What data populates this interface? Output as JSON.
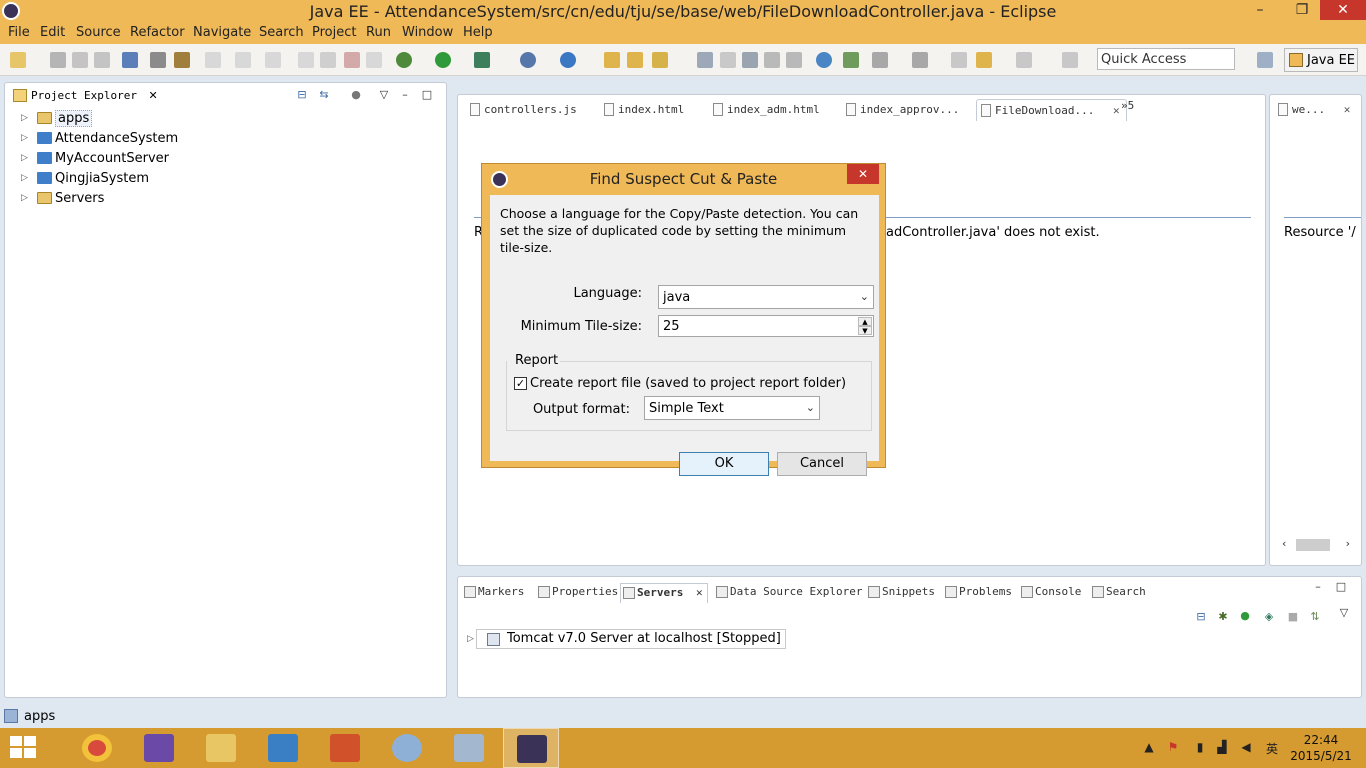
{
  "window": {
    "title": "Java EE - AttendanceSystem/src/cn/edu/tju/se/base/web/FileDownloadController.java - Eclipse",
    "minimize": "–",
    "maximize": "❐",
    "close": "✕"
  },
  "menu": [
    "File",
    "Edit",
    "Source",
    "Refactor",
    "Navigate",
    "Search",
    "Project",
    "Run",
    "Window",
    "Help"
  ],
  "toolbar": {
    "quick_access_placeholder": "Quick Access",
    "perspective_label": "Java EE"
  },
  "project_explorer": {
    "title": "Project Explorer",
    "close": "✕",
    "items": [
      {
        "label": "apps"
      },
      {
        "label": "AttendanceSystem"
      },
      {
        "label": "MyAccountServer"
      },
      {
        "label": "QingjiaSystem"
      },
      {
        "label": "Servers"
      }
    ]
  },
  "editor": {
    "tabs": [
      {
        "label": "controllers.js"
      },
      {
        "label": "index.html"
      },
      {
        "label": "index_adm.html"
      },
      {
        "label": "index_approv..."
      },
      {
        "label": "FileDownload..."
      }
    ],
    "overflow_label": "»5",
    "message_left": "R",
    "message": "adController.java' does not exist.",
    "close": "✕"
  },
  "right_panel": {
    "tab_label": "we...",
    "message": "Resource '/",
    "close": "✕"
  },
  "bottom_panel": {
    "tabs": [
      {
        "label": "Markers"
      },
      {
        "label": "Properties"
      },
      {
        "label": "Servers"
      },
      {
        "label": "Data Source Explorer"
      },
      {
        "label": "Snippets"
      },
      {
        "label": "Problems"
      },
      {
        "label": "Console"
      },
      {
        "label": "Search"
      }
    ],
    "server_row": "Tomcat v7.0 Server at localhost  [Stopped]"
  },
  "status_bar": {
    "text": "apps"
  },
  "taskbar": {
    "time": "22:44",
    "date": "2015/5/21",
    "ime": "英"
  },
  "dialog": {
    "title": "Find Suspect Cut & Paste",
    "close": "✕",
    "description": "Choose a language for the Copy/Paste detection. You can set the size of duplicated code by setting the minimum tile-size.",
    "language_label": "Language:",
    "language_value": "java",
    "tile_label": "Minimum Tile-size:",
    "tile_value": "25",
    "report_group": "Report",
    "create_report_label": "Create report file (saved to project report folder)",
    "create_report_checked": "✓",
    "output_format_label": "Output format:",
    "output_format_value": "Simple Text",
    "ok": "OK",
    "cancel": "Cancel"
  }
}
